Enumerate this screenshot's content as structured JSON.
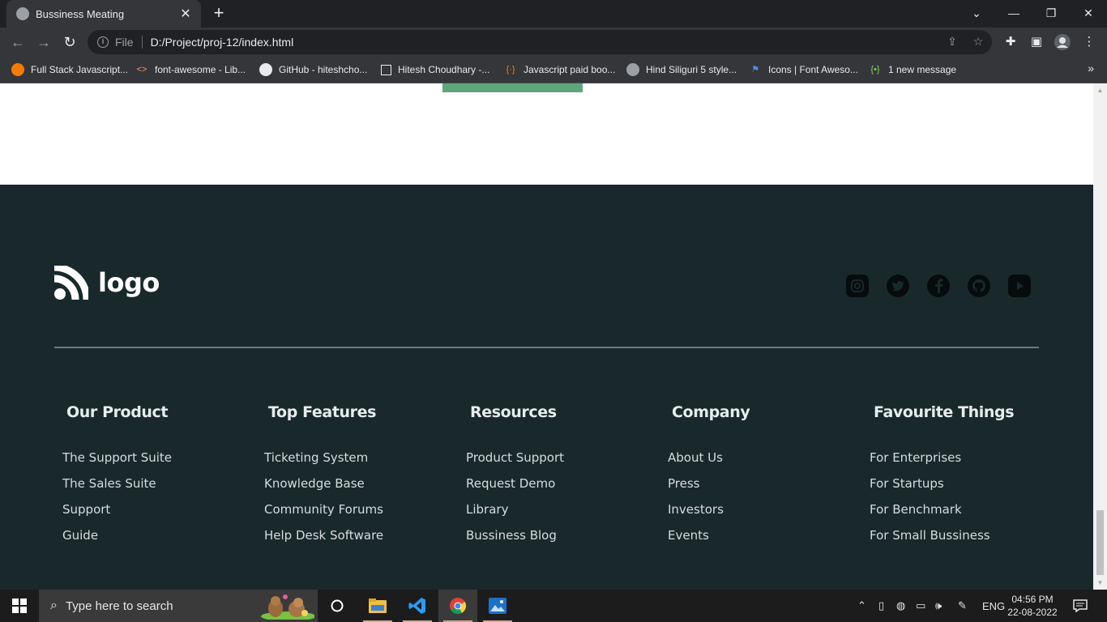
{
  "browser": {
    "tab_title": "Bussiness Meating",
    "url_scheme": "File",
    "url": "D:/Project/proj-12/index.html",
    "bookmarks": [
      {
        "label": "Full Stack Javascript...",
        "icon": "orange-circle-icon"
      },
      {
        "label": "font-awesome - Lib...",
        "icon": "code-brackets-icon"
      },
      {
        "label": "GitHub - hiteshcho...",
        "icon": "github-icon"
      },
      {
        "label": "Hitesh Choudhary -...",
        "icon": "square-icon"
      },
      {
        "label": "Javascript paid boo...",
        "icon": "curly-braces-icon"
      },
      {
        "label": "Hind Siliguri 5 style...",
        "icon": "globe-icon"
      },
      {
        "label": "Icons | Font Aweso...",
        "icon": "flag-icon"
      },
      {
        "label": "1 new message",
        "icon": "chat-braces-icon"
      }
    ]
  },
  "footer": {
    "logo_text": "logo",
    "socials": [
      "instagram-icon",
      "twitter-icon",
      "facebook-icon",
      "github-icon",
      "youtube-icon"
    ],
    "columns": [
      {
        "heading": "Our Product",
        "links": [
          "The Support Suite",
          "The Sales Suite",
          "Support",
          "Guide"
        ]
      },
      {
        "heading": "Top Features",
        "links": [
          "Ticketing System",
          "Knowledge Base",
          "Community Forums",
          "Help Desk Software"
        ]
      },
      {
        "heading": "Resources",
        "links": [
          "Product Support",
          "Request Demo",
          "Library",
          "Bussiness Blog"
        ]
      },
      {
        "heading": "Company",
        "links": [
          "About Us",
          "Press",
          "Investors",
          "Events"
        ]
      },
      {
        "heading": "Favourite Things",
        "links": [
          "For Enterprises",
          "For Startups",
          "For Benchmark",
          "For Small Bussiness"
        ]
      }
    ],
    "colors": {
      "background": "#19292b",
      "accent": "#5ea57e"
    }
  },
  "taskbar": {
    "search_placeholder": "Type here to search",
    "language": "ENG",
    "time": "04:56 PM",
    "date": "22-08-2022"
  }
}
